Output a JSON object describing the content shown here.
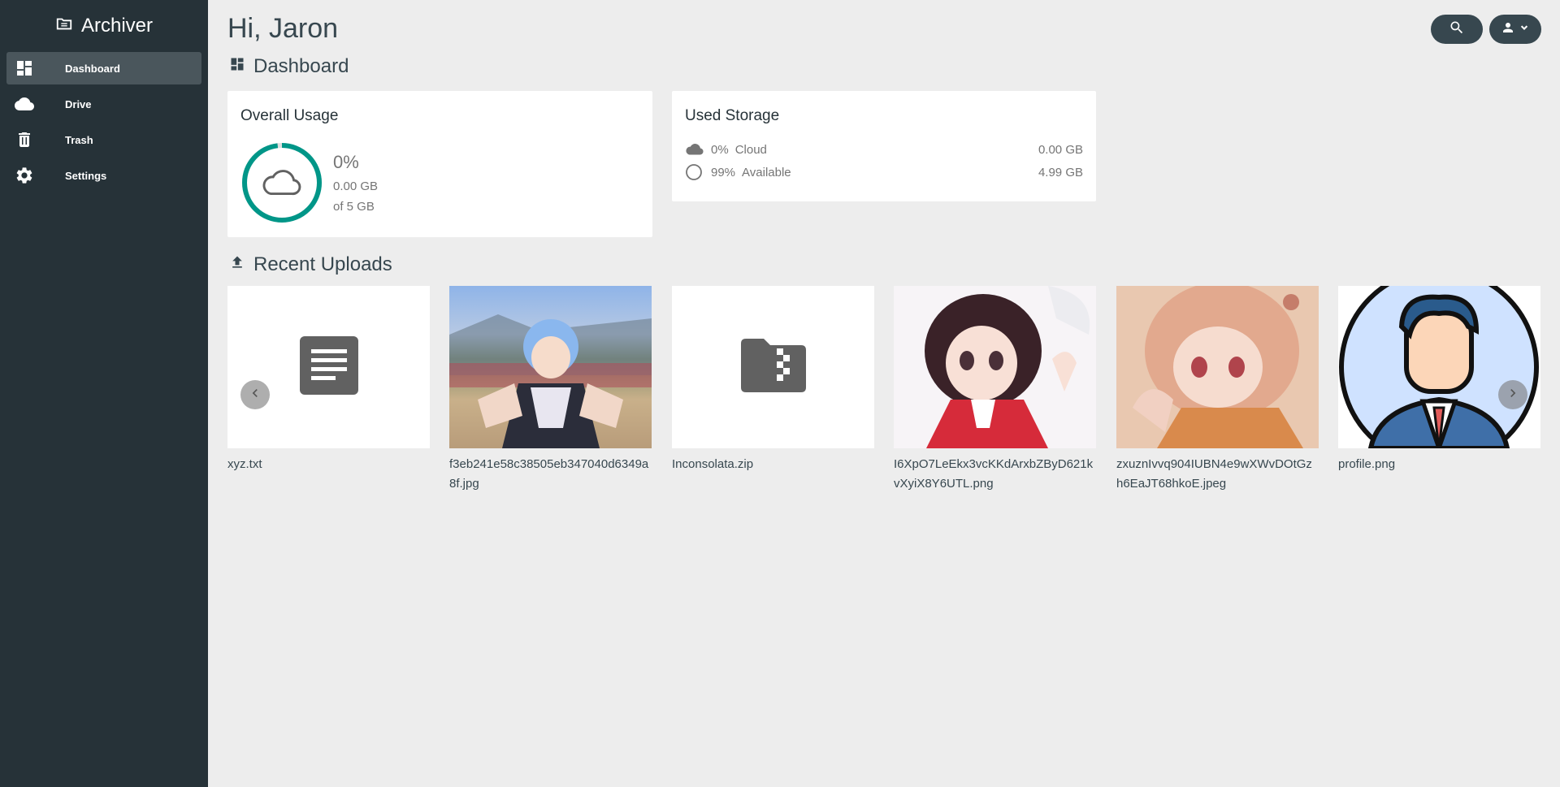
{
  "app": {
    "name": "Archiver"
  },
  "sidebar": {
    "items": [
      {
        "label": "Dashboard",
        "icon": "dashboard-icon",
        "active": true
      },
      {
        "label": "Drive",
        "icon": "cloud-icon",
        "active": false
      },
      {
        "label": "Trash",
        "icon": "trash-icon",
        "active": false
      },
      {
        "label": "Settings",
        "icon": "gear-icon",
        "active": false
      }
    ]
  },
  "header": {
    "greeting": "Hi, Jaron"
  },
  "dashboard": {
    "title": "Dashboard"
  },
  "overall_usage": {
    "title": "Overall Usage",
    "percent": "0%",
    "used": "0.00 GB",
    "total": "of 5 GB",
    "used_fraction": 0.01
  },
  "used_storage": {
    "title": "Used Storage",
    "rows": [
      {
        "percent": "0%",
        "label": "Cloud",
        "value": "0.00 GB",
        "icon": "cloud-icon"
      },
      {
        "percent": "99%",
        "label": "Available",
        "value": "4.99 GB",
        "icon": "circle-outline-icon"
      }
    ]
  },
  "recent_uploads": {
    "title": "Recent Uploads",
    "files": [
      {
        "name": "xyz.txt",
        "kind": "text"
      },
      {
        "name": "f3eb241e58c38505eb347040d6349a8f.jpg",
        "kind": "image"
      },
      {
        "name": "Inconsolata.zip",
        "kind": "archive"
      },
      {
        "name": "I6XpO7LeEkx3vcKKdArxbZByD621kvXyiX8Y6UTL.png",
        "kind": "image"
      },
      {
        "name": "zxuznIvvq904IUBN4e9wXWvDOtGzh6EaJT68hkoE.jpeg",
        "kind": "image"
      },
      {
        "name": "profile.png",
        "kind": "image"
      }
    ]
  },
  "colors": {
    "sidebar_bg": "#263238",
    "accent_ring": "#009688",
    "main_bg": "#ededed"
  }
}
